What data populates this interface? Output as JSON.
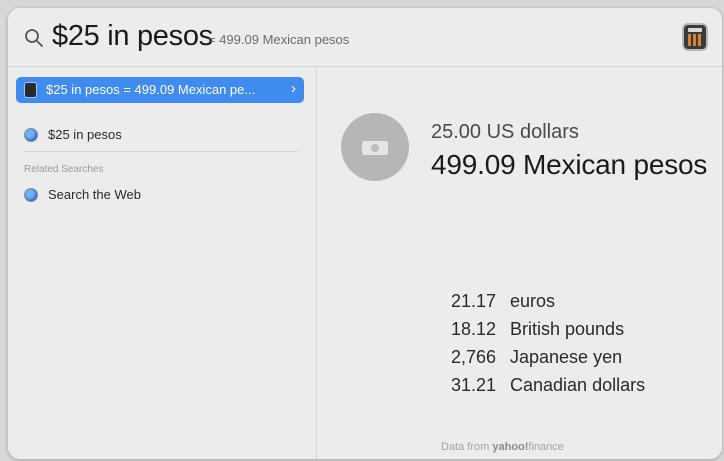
{
  "search": {
    "query": "$25 in pesos",
    "inline_result": "= 499.09 Mexican pesos"
  },
  "sidebar": {
    "selected": {
      "label": "$25 in pesos = 499.09 Mexican pe...",
      "chevron": "›",
      "icon": "calculator-icon"
    },
    "items": [
      {
        "label": "$25 in pesos",
        "icon": "safari-icon"
      }
    ],
    "section_header": "Related Searches",
    "related": [
      {
        "label": "Search the Web",
        "icon": "safari-icon"
      }
    ]
  },
  "main": {
    "from_amount": "25.00 US dollars",
    "to_amount": "499.09 Mexican pesos",
    "conversions": [
      {
        "value": "21.17",
        "currency": "euros"
      },
      {
        "value": "18.12",
        "currency": "British pounds"
      },
      {
        "value": "2,766",
        "currency": "Japanese yen"
      },
      {
        "value": "31.21",
        "currency": "Canadian dollars"
      }
    ],
    "footer": {
      "prefix": "Data from ",
      "brand": "yahoo!",
      "suffix": "finance"
    }
  },
  "colors": {
    "accent": "#3f8bee",
    "background": "#ececec"
  }
}
